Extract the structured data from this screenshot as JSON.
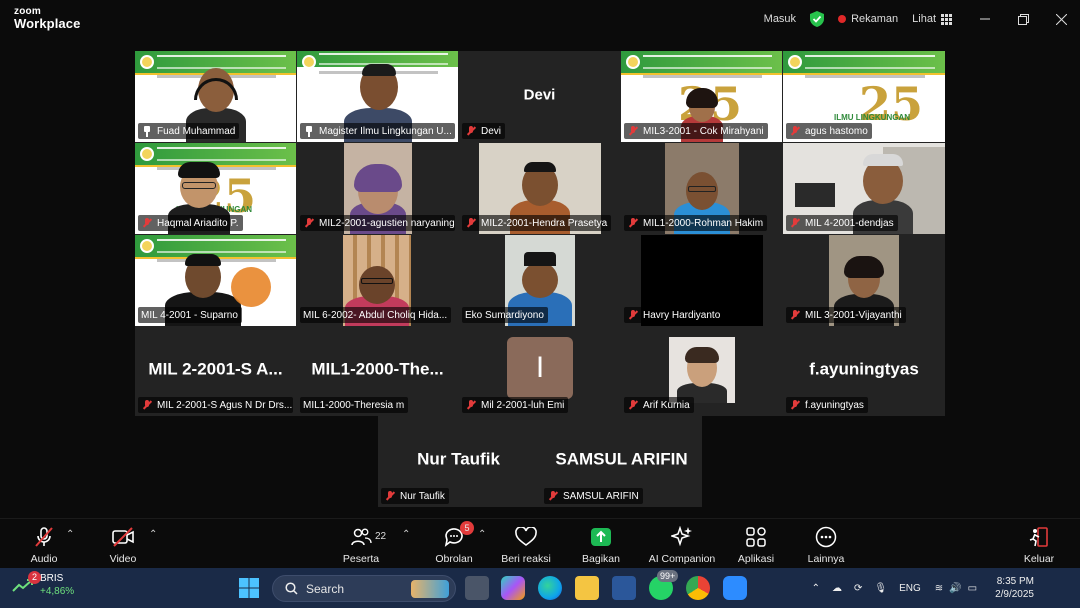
{
  "app": {
    "brand_line1": "zoom",
    "brand_line2": "Workplace"
  },
  "titlebar": {
    "sign_in": "Masuk",
    "recording": "Rekaman",
    "view": "Lihat"
  },
  "participants": [
    "Fuad Muhammad",
    "Magister Ilmu Lingkungan U...",
    "Devi",
    "MIL3-2001 - Cok Mirahyani",
    "agus hastomo",
    "Haqmal Ariadito P.",
    "MIL2-2001-agustien naryaning...",
    "MIL2-2001-Hendra Prasetya",
    "MIL1-2000-Rohman Hakim",
    "MIL 4-2001-dendjas",
    "MIL 4-2001 - Suparno",
    "MIL 6-2002- Abdul Choliq Hida...",
    "Eko Sumardiyono",
    "Havry Hardiyanto",
    "MIL 3-2001-Vijayanthi",
    "MIL 2-2001-S Agus N Dr Drs...",
    "MIL1-2000-Theresia m",
    "Mil 2-2001-luh Emi",
    "Arif Kurnia",
    "f.ayuningtyas",
    "Nur Taufik",
    "SAMSUL ARIFIN"
  ],
  "big_names": {
    "devi": "Devi",
    "sagus": "MIL  2-2001-S  A...",
    "theresia": "MIL1-2000-The...",
    "luh": "I",
    "ayuning": "f.ayuningtyas",
    "nur": "Nur Taufik",
    "samsul": "SAMSUL ARIFIN"
  },
  "slide_text": {
    "number": "25",
    "subtitle": "ILMU LINGKUNGAN"
  },
  "toolbar": {
    "audio": "Audio",
    "video": "Video",
    "participants": "Peserta",
    "participants_count": "22",
    "chat": "Obrolan",
    "chat_badge": "5",
    "reactions": "Beri reaksi",
    "share": "Bagikan",
    "ai": "AI Companion",
    "apps": "Aplikasi",
    "more": "Lainnya",
    "leave": "Keluar"
  },
  "taskbar": {
    "ticker_symbol": "BRIS",
    "ticker_change": "+4,86%",
    "ticker_badge": "2",
    "search_placeholder": "Search",
    "whatsapp_badge": "99+",
    "language": "ENG",
    "time": "8:35 PM",
    "date": "2/9/2025"
  },
  "colors": {
    "accent_green": "#27c24c",
    "mute_red": "#e23b3b",
    "share_green": "#1db954",
    "leave_red": "#e23b3b"
  }
}
